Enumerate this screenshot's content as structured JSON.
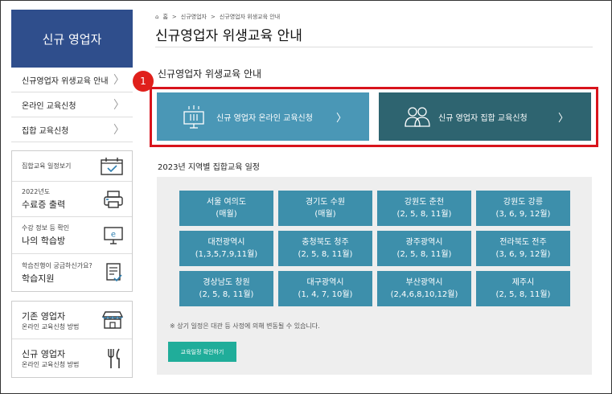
{
  "sidebar": {
    "header": "신규 영업자",
    "menu": [
      {
        "label": "신규영업자 위생교육 안내"
      },
      {
        "label": "온라인 교육신청"
      },
      {
        "label": "집합 교육신청"
      }
    ],
    "quick_links": [
      {
        "small": "",
        "big": "집합교육 일정보기",
        "icon": "calendar-check-icon"
      },
      {
        "small": "2022년도",
        "big": "수료증 출력",
        "icon": "printer-icon"
      },
      {
        "small": "수강 정보 등 확인",
        "big": "나의 학습방",
        "icon": "monitor-e-icon"
      },
      {
        "small": "학습진행이 궁금하신가요?",
        "big": "학습지원",
        "icon": "document-check-icon"
      }
    ],
    "guides": [
      {
        "title": "기존 영업자",
        "sub": "온라인 교육신청 방법",
        "icon": "storefront-icon"
      },
      {
        "title": "신규 영업자",
        "sub": "온라인 교육신청 방법",
        "icon": "fork-knife-icon"
      }
    ],
    "chevron": "〉"
  },
  "breadcrumb": [
    "홈",
    "신규영업자",
    "신규영업자 위생교육 안내"
  ],
  "page_title": "신규영업자 위생교육 안내",
  "section_title": "신규영업자 위생교육 안내",
  "annotation_badge": "1",
  "buttons": {
    "online": "신규 영업자 온라인 교육신청",
    "group": "신규 영업자 집합 교육신청",
    "arrow": "〉"
  },
  "schedule": {
    "title": "2023년 지역별 집합교육 일정",
    "tiles": [
      {
        "city": "서울 여의도",
        "months": "(매월)"
      },
      {
        "city": "경기도 수원",
        "months": "(매월)"
      },
      {
        "city": "강원도 춘천",
        "months": "(2, 5, 8, 11월)"
      },
      {
        "city": "강원도 강릉",
        "months": "(3, 6, 9, 12월)"
      },
      {
        "city": "대전광역시",
        "months": "(1,3,5,7,9,11월)"
      },
      {
        "city": "충청북도 청주",
        "months": "(2, 5, 8, 11월)"
      },
      {
        "city": "광주광역시",
        "months": "(2, 5, 8, 11월)"
      },
      {
        "city": "전라북도 전주",
        "months": "(3, 6, 9, 12월)"
      },
      {
        "city": "경상남도 창원",
        "months": "(2, 5, 8, 11월)"
      },
      {
        "city": "대구광역시",
        "months": "(1, 4, 7, 10월)"
      },
      {
        "city": "부산광역시",
        "months": "(2,4,6,8,10,12월)"
      },
      {
        "city": "제주시",
        "months": "(2, 5, 8, 11월)"
      }
    ],
    "note": "※ 상기 일정은 대관 등 사정에 의해 변동될 수 있습니다.",
    "confirm_label": "교육일정 확인하기"
  },
  "colors": {
    "sidebar_header": "#2f4e8c",
    "online_button": "#4a97b6",
    "group_button": "#2e6470",
    "tile": "#3d8fab",
    "confirm_button": "#20ad9a",
    "highlight": "#d8141c"
  }
}
